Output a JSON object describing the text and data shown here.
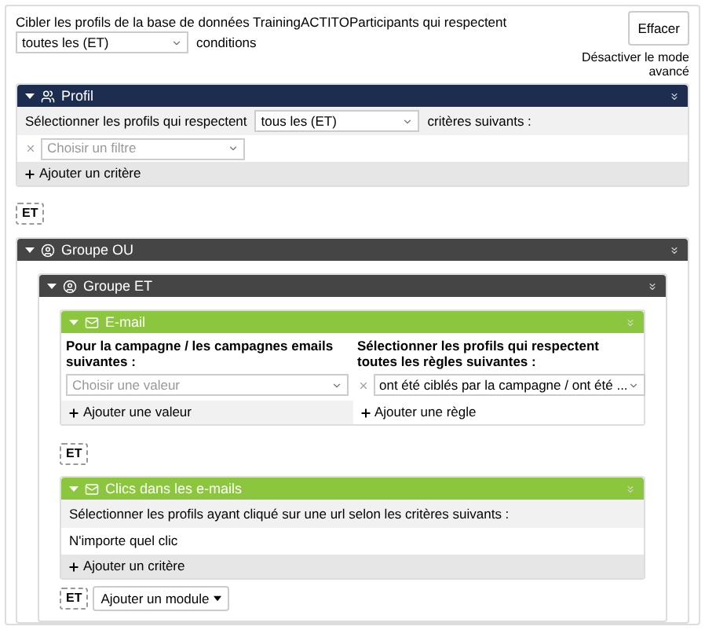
{
  "header": {
    "text_before": "Cibler les profils de la base de données TrainingACTITOParticipants qui respectent",
    "match_select": "toutes les (ET)",
    "text_after": "conditions",
    "clear_button": "Effacer",
    "mode_link": "Désactiver le mode avancé"
  },
  "profile": {
    "title": "Profil",
    "expanded": true,
    "select_label": "Sélectionner les profils qui respectent",
    "match_select": "tous les (ET)",
    "select_suffix": "critères suivants :",
    "filter_placeholder": "Choisir un filtre",
    "add_button": "Ajouter un critère"
  },
  "connector": "ET",
  "or_group": {
    "title": "Groupe OU",
    "expanded": true,
    "and_group": {
      "title": "Groupe ET",
      "expanded": true,
      "modules": [
        {
          "kind": "email",
          "title": "E-mail",
          "expanded": true,
          "left_label": "Pour la campagne / les campagnes emails suivantes :",
          "value_placeholder": "Choisir une valeur",
          "right_label": "Sélectionner les profils qui respectent toutes les règles suivantes :",
          "rule_select": "ont été ciblés par la campagne / ont été ...",
          "add_value": "Ajouter une valeur",
          "add_rule": "Ajouter une règle",
          "connector_after": "ET"
        },
        {
          "kind": "clicks",
          "title": "Clics dans les e-mails",
          "expanded": true,
          "description": "Sélectionner les profils ayant cliqué sur une url selon les critères suivants :",
          "criterion": "N'importe quel clic",
          "add_button": "Ajouter un critère"
        }
      ],
      "final_connector": "ET",
      "add_module_button": "Ajouter un module"
    }
  }
}
